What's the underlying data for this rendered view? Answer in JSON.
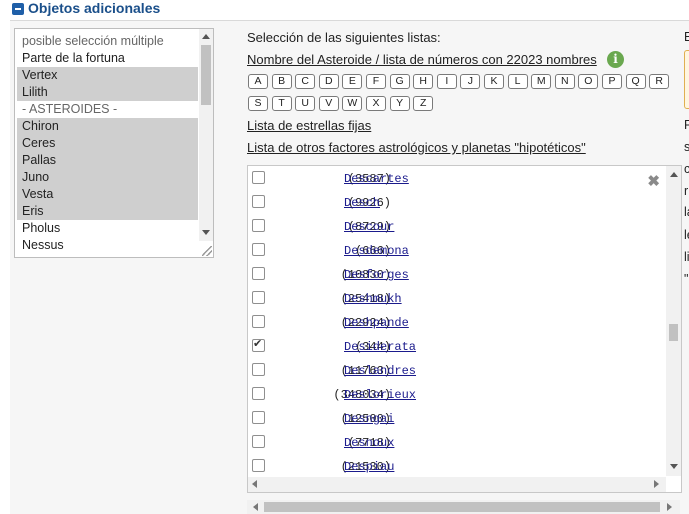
{
  "section": {
    "title": "Objetos adicionales"
  },
  "objects_select": {
    "options": [
      {
        "label": "posible selección múltiple",
        "selected": false,
        "header": true
      },
      {
        "label": "Parte de la fortuna",
        "selected": false
      },
      {
        "label": "Vertex",
        "selected": true
      },
      {
        "label": "Lilith",
        "selected": true
      },
      {
        "label": "- ASTEROIDES -",
        "selected": false,
        "header": true
      },
      {
        "label": "Chiron",
        "selected": true
      },
      {
        "label": "Ceres",
        "selected": true
      },
      {
        "label": "Pallas",
        "selected": true
      },
      {
        "label": "Juno",
        "selected": true
      },
      {
        "label": "Vesta",
        "selected": true
      },
      {
        "label": "Eris",
        "selected": true
      },
      {
        "label": "Pholus",
        "selected": false
      },
      {
        "label": "Nessus",
        "selected": false
      }
    ]
  },
  "lists": {
    "intro": "Selección de las siguientes listas:",
    "asteroid_link": "Nombre del Asteroide / lista de números con 22023 nombres",
    "info_icon": "i",
    "fixed_stars_link": "Lista de estrellas fijas",
    "other_factors_link": "Lista de otros factores astrológicos y planetas \"hipotéticos\""
  },
  "alphabet": [
    "A",
    "B",
    "C",
    "D",
    "E",
    "F",
    "G",
    "H",
    "I",
    "J",
    "K",
    "L",
    "M",
    "N",
    "O",
    "P",
    "Q",
    "R",
    "S",
    "T",
    "U",
    "V",
    "W",
    "X",
    "Y",
    "Z"
  ],
  "asteroids": [
    {
      "num": "(3587)",
      "name": "Descartes",
      "checked": false
    },
    {
      "num": "(9926)",
      "name": "Desch",
      "checked": false
    },
    {
      "num": "(8729)",
      "name": "Descour",
      "checked": false
    },
    {
      "num": "(666)",
      "name": "Desdemona",
      "checked": false
    },
    {
      "num": "(10830)",
      "name": "Desforges",
      "checked": false
    },
    {
      "num": "(25418)",
      "name": "Deshmukh",
      "checked": false
    },
    {
      "num": "(22924)",
      "name": "Deshpande",
      "checked": false
    },
    {
      "num": "(344)",
      "name": "Desiderata",
      "checked": true
    },
    {
      "num": "(11763)",
      "name": "Deslandres",
      "checked": false
    },
    {
      "num": "(348034)",
      "name": "Deslorieux",
      "checked": false
    },
    {
      "num": "(12500)",
      "name": "Desngai",
      "checked": false
    },
    {
      "num": "(7718)",
      "name": "Desnoux",
      "checked": false
    },
    {
      "num": "(21530)",
      "name": "Despiau",
      "checked": false
    }
  ],
  "close_glyph": "✖",
  "right_column_fragments": [
    "E",
    "F",
    "s",
    "c",
    "r",
    "la",
    "le",
    "li",
    "\""
  ]
}
